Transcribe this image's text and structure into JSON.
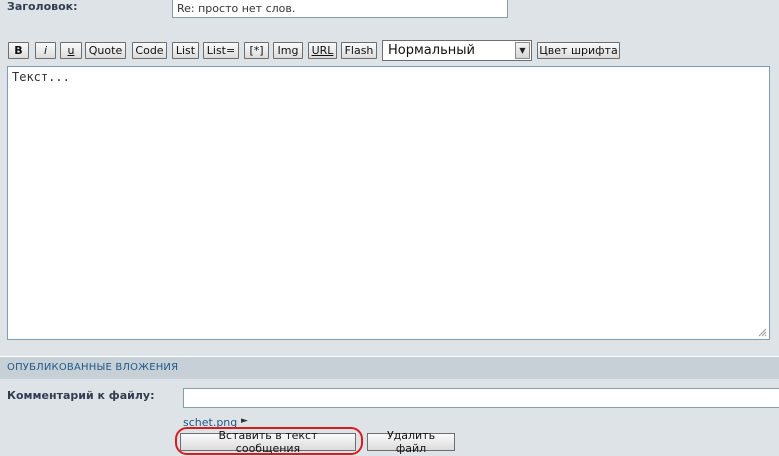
{
  "subject": {
    "label": "Заголовок:",
    "value": "Re: просто нет слов."
  },
  "toolbar": {
    "buttons": [
      "B",
      "i",
      "u",
      "Quote",
      "Code",
      "List",
      "List=",
      "[*]",
      "Img",
      "URL",
      "Flash"
    ],
    "font_size_select": "Нормальный",
    "font_color_button": "Цвет шрифта"
  },
  "message": {
    "text": "Текст..."
  },
  "attachments": {
    "section_title": "ОПУБЛИКОВАННЫЕ ВЛОЖЕНИЯ",
    "comment_label": "Комментарий к файлу:",
    "comment_value": "",
    "filename": "schet.png",
    "insert_button": "Вставить в текст сообщения",
    "delete_button": "Удалить файл"
  },
  "colors": {
    "highlight_ring": "#d81c1c",
    "link": "#1d5987",
    "background": "#dee3e7"
  }
}
